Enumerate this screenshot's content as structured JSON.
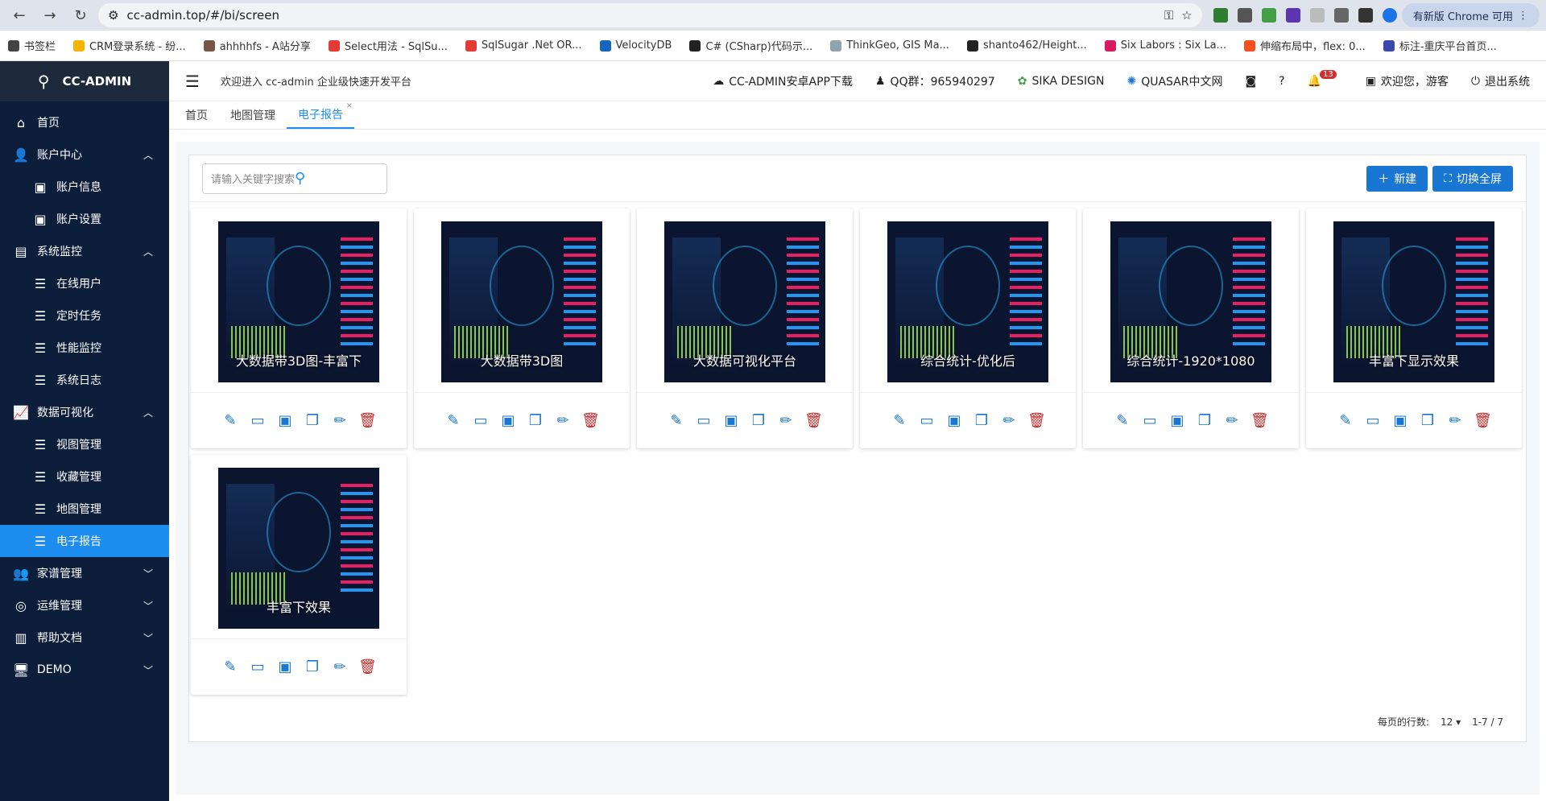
{
  "browser": {
    "url": "cc-admin.top/#/bi/screen",
    "update_label": "有新版 Chrome 可用",
    "bookmarks": [
      {
        "label": "书签栏",
        "color": "#444"
      },
      {
        "label": "CRM登录系统 - 纷...",
        "color": "#f4b400"
      },
      {
        "label": "ahhhhfs - A站分享",
        "color": "#795548"
      },
      {
        "label": "Select用法 - SqlSu...",
        "color": "#e53935"
      },
      {
        "label": "SqlSugar .Net OR...",
        "color": "#e53935"
      },
      {
        "label": "VelocityDB",
        "color": "#1565c0"
      },
      {
        "label": "C# (CSharp)代码示...",
        "color": "#222"
      },
      {
        "label": "ThinkGeo, GIS Ma...",
        "color": "#90a4ae"
      },
      {
        "label": "shanto462/Height...",
        "color": "#222"
      },
      {
        "label": "Six Labors : Six La...",
        "color": "#d81b60"
      },
      {
        "label": "伸缩布局中，flex: 0...",
        "color": "#f4511e"
      },
      {
        "label": "标注-重庆平台首页...",
        "color": "#3949ab"
      }
    ]
  },
  "sidebar": {
    "brand": "CC-ADMIN",
    "items": [
      {
        "label": "首页",
        "icon": "home-icon",
        "glyph": "⌂",
        "level": 0,
        "chevron": ""
      },
      {
        "label": "账户中心",
        "icon": "user-icon",
        "glyph": "👤",
        "level": 0,
        "chevron": "︿"
      },
      {
        "label": "账户信息",
        "icon": "badge-icon",
        "glyph": "▣",
        "level": 1,
        "chevron": ""
      },
      {
        "label": "账户设置",
        "icon": "badge-icon",
        "glyph": "▣",
        "level": 1,
        "chevron": ""
      },
      {
        "label": "系统监控",
        "icon": "monitor-icon",
        "glyph": "▤",
        "level": 0,
        "chevron": "︿"
      },
      {
        "label": "在线用户",
        "icon": "list-icon",
        "glyph": "☰",
        "level": 1,
        "chevron": ""
      },
      {
        "label": "定时任务",
        "icon": "list-icon",
        "glyph": "☰",
        "level": 1,
        "chevron": ""
      },
      {
        "label": "性能监控",
        "icon": "list-icon",
        "glyph": "☰",
        "level": 1,
        "chevron": ""
      },
      {
        "label": "系统日志",
        "icon": "list-icon",
        "glyph": "☰",
        "level": 1,
        "chevron": ""
      },
      {
        "label": "数据可视化",
        "icon": "chart-icon",
        "glyph": "📈",
        "level": 0,
        "chevron": "︿"
      },
      {
        "label": "视图管理",
        "icon": "list-icon",
        "glyph": "☰",
        "level": 1,
        "chevron": ""
      },
      {
        "label": "收藏管理",
        "icon": "list-icon",
        "glyph": "☰",
        "level": 1,
        "chevron": ""
      },
      {
        "label": "地图管理",
        "icon": "list-icon",
        "glyph": "☰",
        "level": 1,
        "chevron": ""
      },
      {
        "label": "电子报告",
        "icon": "list-icon",
        "glyph": "☰",
        "level": 1,
        "chevron": "",
        "active": true
      },
      {
        "label": "家谱管理",
        "icon": "group-icon",
        "glyph": "👥",
        "level": 0,
        "chevron": "﹀"
      },
      {
        "label": "运维管理",
        "icon": "owl-icon",
        "glyph": "◎",
        "level": 0,
        "chevron": "﹀"
      },
      {
        "label": "帮助文档",
        "icon": "book-icon",
        "glyph": "▥",
        "level": 0,
        "chevron": "﹀"
      },
      {
        "label": "DEMO",
        "icon": "desktop-icon",
        "glyph": "🖥",
        "level": 0,
        "chevron": "﹀"
      }
    ]
  },
  "header": {
    "welcome": "欢迎进入 cc-admin 企业级快速开发平台",
    "download": "CC-ADMIN安卓APP下载",
    "qq": "QQ群：965940297",
    "sika": "SIKA DESIGN",
    "quasar": "QUASAR中文网",
    "notif_count": "13",
    "greeting": "欢迎您，游客",
    "logout": "退出系统"
  },
  "tabs": [
    {
      "label": "首页",
      "active": false
    },
    {
      "label": "地图管理",
      "active": false
    },
    {
      "label": "电子报告",
      "active": true
    }
  ],
  "toolbar": {
    "search_placeholder": "请输入关键字搜索",
    "new_label": "新建",
    "fullscreen_label": "切换全屏"
  },
  "cards": [
    {
      "title": "大数据带3D图-丰富下"
    },
    {
      "title": "大数据带3D图"
    },
    {
      "title": "大数据可视化平台"
    },
    {
      "title": "综合统计-优化后"
    },
    {
      "title": "综合统计-1920*1080"
    },
    {
      "title": "丰富下显示效果"
    },
    {
      "title": "丰富下效果"
    }
  ],
  "pager": {
    "rows_label": "每页的行数:",
    "rows_value": "12",
    "range": "1-7 / 7"
  }
}
